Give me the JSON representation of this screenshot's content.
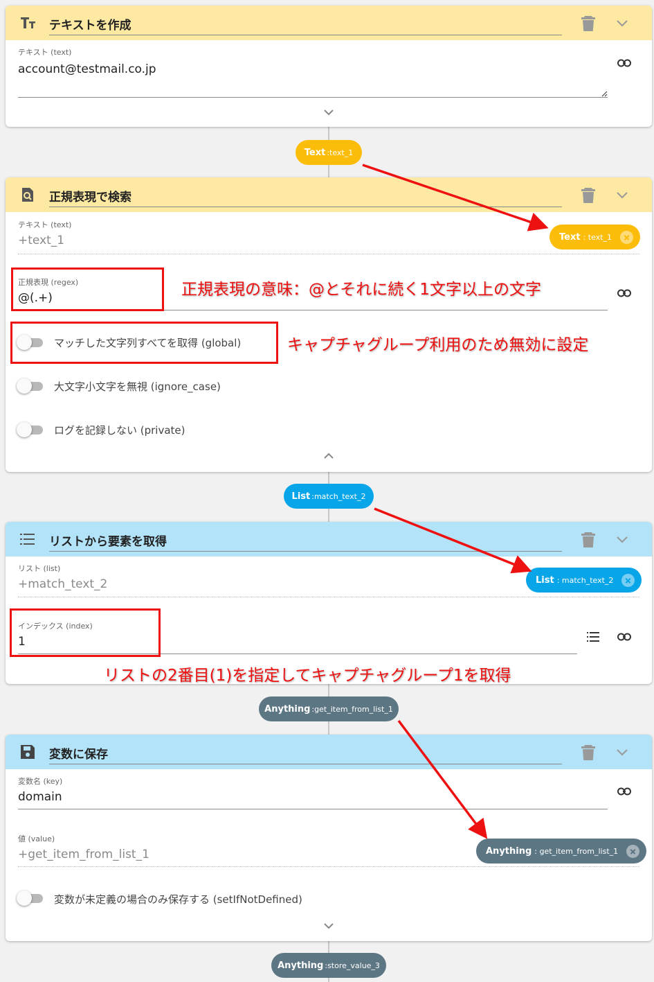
{
  "colors": {
    "header_yellow": "#fde9a2",
    "header_blue": "#b3e3f8",
    "pill_text": "#fbbd0a",
    "pill_list": "#08a6e8",
    "pill_anything": "#5d7684",
    "annotation_red": "#ee1111"
  },
  "card1": {
    "icon": "text-format-icon",
    "title": "テキストを作成",
    "field_label": "テキスト (text)",
    "field_value": "account@testmail.co.jp"
  },
  "pill1": {
    "type": "Text",
    "name": ":text_1"
  },
  "card2": {
    "icon": "regex-search-icon",
    "title": "正規表現で検索",
    "text_label": "テキスト (text)",
    "text_placeholder": "+text_1",
    "text_chip": {
      "type": "Text",
      "name": ": text_1"
    },
    "regex_label": "正規表現 (regex)",
    "regex_value": "@(.+)",
    "global_label": "マッチした文字列すべてを取得 (global)",
    "ignore_case_label": "大文字小文字を無視 (ignore_case)",
    "private_label": "ログを記録しない (private)"
  },
  "pill2": {
    "type": "List",
    "name": ":match_text_2"
  },
  "card3": {
    "icon": "list-icon",
    "title": "リストから要素を取得",
    "list_label": "リスト (list)",
    "list_placeholder": "+match_text_2",
    "list_chip": {
      "type": "List",
      "name": ": match_text_2"
    },
    "index_label": "インデックス (index)",
    "index_value": "1"
  },
  "pill3": {
    "type": "Anything",
    "name": ":get_item_from_list_1"
  },
  "card4": {
    "icon": "save-icon",
    "title": "変数に保存",
    "key_label": "変数名 (key)",
    "key_value": "domain",
    "value_label": "値 (value)",
    "value_placeholder": "+get_item_from_list_1",
    "value_chip": {
      "type": "Anything",
      "name": ": get_item_from_list_1"
    },
    "set_if_label": "変数が未定義の場合のみ保存する (setIfNotDefined)"
  },
  "pill4": {
    "type": "Anything",
    "name": ":store_value_3"
  },
  "annotations": {
    "regex_note": "正規表現の意味：@とそれに続く1文字以上の文字",
    "global_note": "キャプチャグループ利用のため無効に設定",
    "index_note": "リストの2番目(1)を指定してキャプチャグループ1を取得"
  }
}
